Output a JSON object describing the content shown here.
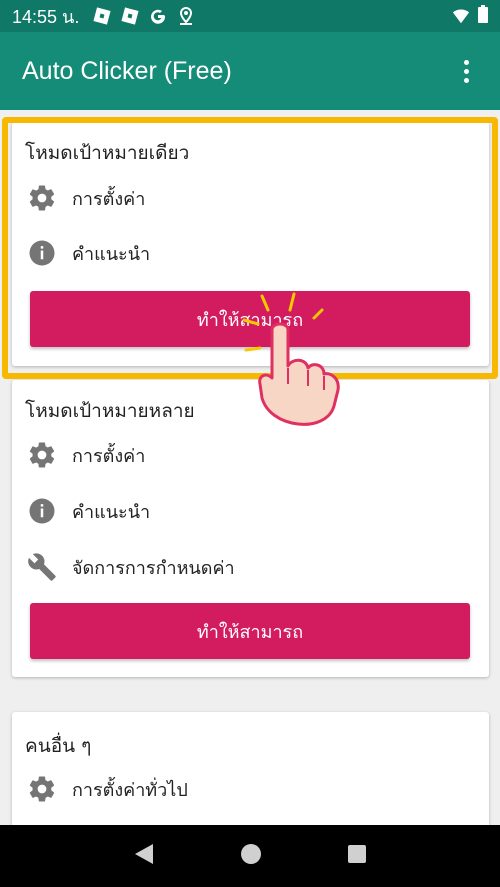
{
  "status_bar": {
    "time": "14:55 น.",
    "icons": [
      "roblox-icon",
      "roblox-icon",
      "google-icon",
      "location-icon",
      "wifi-icon",
      "battery-icon"
    ]
  },
  "app_bar": {
    "title": "Auto Clicker (Free)",
    "menu_icon": "more-vert-icon"
  },
  "single_target": {
    "title": "โหมดเป้าหมายเดียว",
    "items": [
      {
        "icon": "gear-icon",
        "label": "การตั้งค่า"
      },
      {
        "icon": "info-icon",
        "label": "คำแนะนำ"
      }
    ],
    "enable_label": "ทำให้สามารถ"
  },
  "multi_target": {
    "title": "โหมดเป้าหมายหลาย",
    "items": [
      {
        "icon": "gear-icon",
        "label": "การตั้งค่า"
      },
      {
        "icon": "info-icon",
        "label": "คำแนะนำ"
      },
      {
        "icon": "wrench-icon",
        "label": "จัดการการกำหนดค่า"
      }
    ],
    "enable_label": "ทำให้สามารถ"
  },
  "others": {
    "title": "คนอื่น ๆ",
    "items": [
      {
        "icon": "gear-icon",
        "label": "การตั้งค่าทั่วไป"
      }
    ]
  },
  "colors": {
    "status_bar": "#0f7866",
    "app_bar": "#158c77",
    "button": "#d31b5f",
    "highlight": "#f6b800"
  }
}
